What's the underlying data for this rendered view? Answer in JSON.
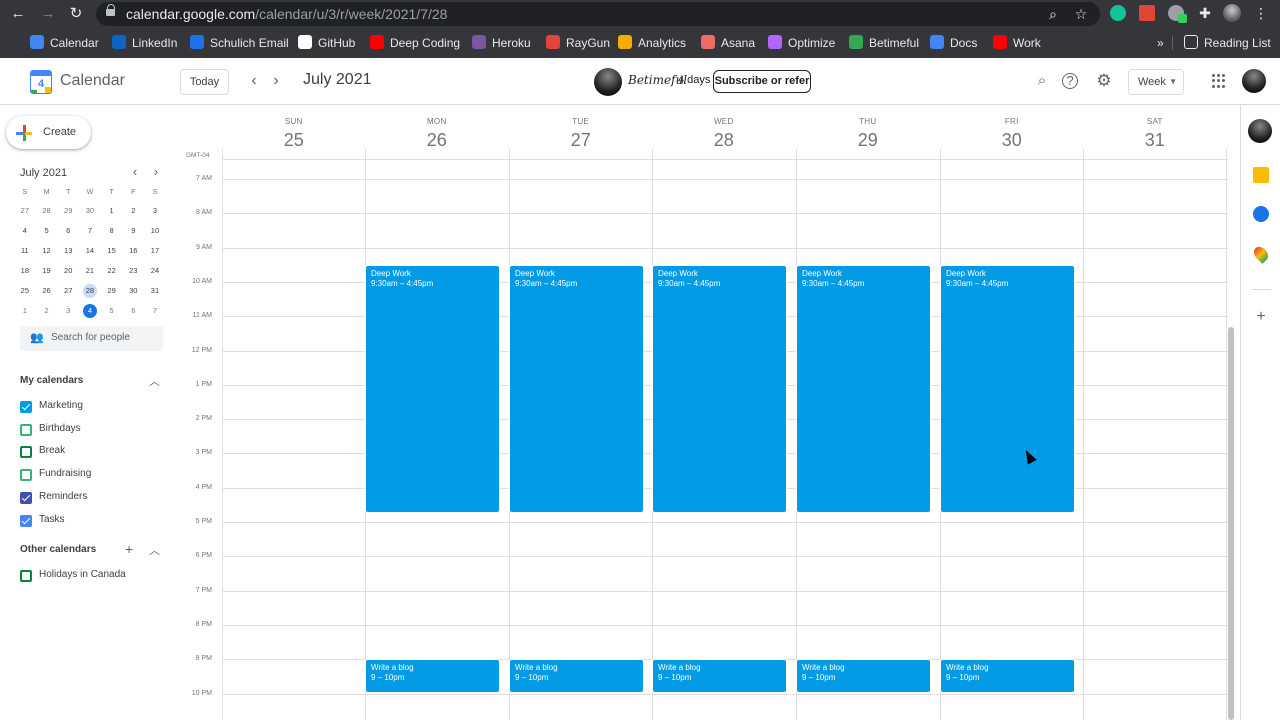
{
  "browser": {
    "url_host": "calendar.google.com",
    "url_path": "/calendar/u/3/r/week/2021/7/28",
    "bookmarks": [
      {
        "label": "Calendar",
        "color": "#4285f4"
      },
      {
        "label": "LinkedIn",
        "color": "#0a66c2"
      },
      {
        "label": "Schulich Email",
        "color": "#1a73e8"
      },
      {
        "label": "GitHub",
        "color": "#ffffff"
      },
      {
        "label": "Deep Coding",
        "color": "#ff0000"
      },
      {
        "label": "Heroku",
        "color": "#79589f"
      },
      {
        "label": "RayGun",
        "color": "#e0453a"
      },
      {
        "label": "Analytics",
        "color": "#f9ab00"
      },
      {
        "label": "Asana",
        "color": "#f06a6a"
      },
      {
        "label": "Optimize",
        "color": "#b366ff"
      },
      {
        "label": "Betimeful",
        "color": "#34a853"
      },
      {
        "label": "Docs",
        "color": "#4285f4"
      },
      {
        "label": "Work",
        "color": "#ff0000"
      }
    ],
    "more": "»",
    "reading_list": "Reading List"
  },
  "header": {
    "logo_day": "4",
    "app_name": "Calendar",
    "today": "Today",
    "month_title": "July 2021",
    "betimeful_name": "Betimeful",
    "betimeful_days": "4 days",
    "subscribe": "Subscribe or refer",
    "view": "Week"
  },
  "sidebar": {
    "create": "Create",
    "mini_title": "July 2021",
    "dow": [
      "S",
      "M",
      "T",
      "W",
      "T",
      "F",
      "S"
    ],
    "weeks": [
      [
        "27",
        "28",
        "29",
        "30",
        "1",
        "2",
        "3"
      ],
      [
        "4",
        "5",
        "6",
        "7",
        "8",
        "9",
        "10"
      ],
      [
        "11",
        "12",
        "13",
        "14",
        "15",
        "16",
        "17"
      ],
      [
        "18",
        "19",
        "20",
        "21",
        "22",
        "23",
        "24"
      ],
      [
        "25",
        "26",
        "27",
        "28",
        "29",
        "30",
        "31"
      ],
      [
        "1",
        "2",
        "3",
        "4",
        "5",
        "6",
        "7"
      ]
    ],
    "search_placeholder": "Search for people",
    "my_calendars_title": "My calendars",
    "my_calendars": [
      {
        "label": "Marketing",
        "color": "#039be5",
        "checked": true
      },
      {
        "label": "Birthdays",
        "color": "#33b679",
        "checked": false
      },
      {
        "label": "Break",
        "color": "#0b8043",
        "checked": false
      },
      {
        "label": "Fundraising",
        "color": "#33b679",
        "checked": false
      },
      {
        "label": "Reminders",
        "color": "#3f51b5",
        "checked": true
      },
      {
        "label": "Tasks",
        "color": "#4285f4",
        "checked": true
      }
    ],
    "other_calendars_title": "Other calendars",
    "other_calendars": [
      {
        "label": "Holidays in Canada",
        "color": "#0b8043",
        "checked": false
      }
    ]
  },
  "week": {
    "timezone": "GMT-04",
    "days": [
      {
        "dow": "SUN",
        "num": "25"
      },
      {
        "dow": "MON",
        "num": "26"
      },
      {
        "dow": "TUE",
        "num": "27"
      },
      {
        "dow": "WED",
        "num": "28"
      },
      {
        "dow": "THU",
        "num": "29"
      },
      {
        "dow": "FRI",
        "num": "30"
      },
      {
        "dow": "SAT",
        "num": "31"
      }
    ],
    "hours": [
      "7 AM",
      "8 AM",
      "9 AM",
      "10 AM",
      "11 AM",
      "12 PM",
      "1 PM",
      "2 PM",
      "3 PM",
      "4 PM",
      "5 PM",
      "6 PM",
      "7 PM",
      "8 PM",
      "9 PM",
      "10 PM"
    ],
    "event_color": "#039be5",
    "events": [
      {
        "day": 1,
        "title": "Deep Work",
        "time": "9:30am – 4:45pm",
        "start": 9.5,
        "end": 16.75
      },
      {
        "day": 2,
        "title": "Deep Work",
        "time": "9:30am – 4:45pm",
        "start": 9.5,
        "end": 16.75
      },
      {
        "day": 3,
        "title": "Deep Work",
        "time": "9:30am – 4:45pm",
        "start": 9.5,
        "end": 16.75
      },
      {
        "day": 4,
        "title": "Deep Work",
        "time": "9:30am – 4:45pm",
        "start": 9.5,
        "end": 16.75
      },
      {
        "day": 5,
        "title": "Deep Work",
        "time": "9:30am – 4:45pm",
        "start": 9.5,
        "end": 16.75
      },
      {
        "day": 1,
        "title": "Write a blog",
        "time": "9 – 10pm",
        "start": 21,
        "end": 22
      },
      {
        "day": 2,
        "title": "Write a blog",
        "time": "9 – 10pm",
        "start": 21,
        "end": 22
      },
      {
        "day": 3,
        "title": "Write a blog",
        "time": "9 – 10pm",
        "start": 21,
        "end": 22
      },
      {
        "day": 4,
        "title": "Write a blog",
        "time": "9 – 10pm",
        "start": 21,
        "end": 22
      },
      {
        "day": 5,
        "title": "Write a blog",
        "time": "9 – 10pm",
        "start": 21,
        "end": 22
      }
    ]
  }
}
